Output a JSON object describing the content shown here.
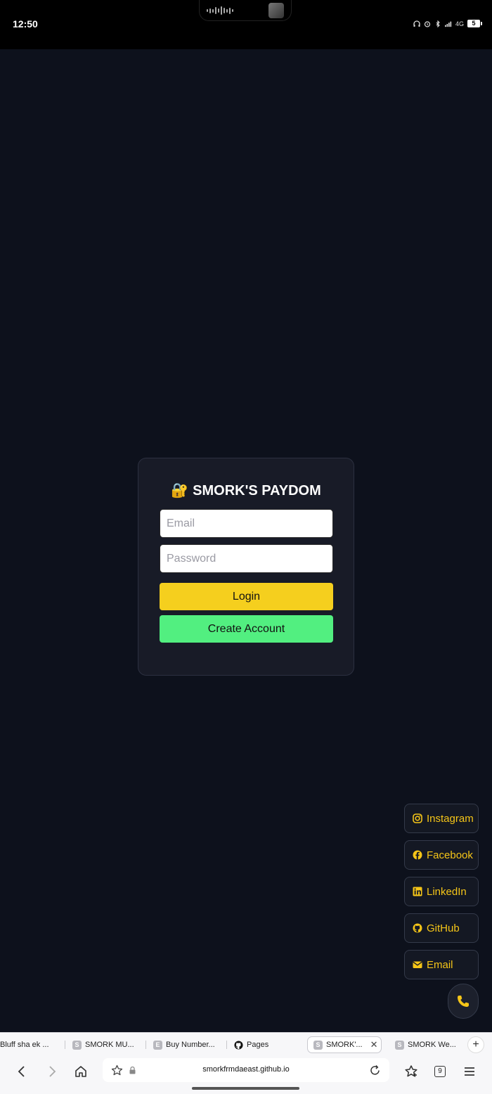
{
  "status_bar": {
    "time": "12:50",
    "network_label": "4G",
    "battery_level": "5"
  },
  "login": {
    "lock_emoji": "🔐",
    "title": "SMORK'S PAYDOM",
    "email_placeholder": "Email",
    "password_placeholder": "Password",
    "login_label": "Login",
    "create_account_label": "Create Account"
  },
  "social_links": [
    {
      "label": "Instagram",
      "icon": "instagram-icon"
    },
    {
      "label": "Facebook",
      "icon": "facebook-icon"
    },
    {
      "label": "LinkedIn",
      "icon": "linkedin-icon"
    },
    {
      "label": "GitHub",
      "icon": "github-icon"
    },
    {
      "label": "Email",
      "icon": "mail-icon"
    }
  ],
  "call_button": {
    "icon": "phone-icon"
  },
  "browser": {
    "tabs": [
      {
        "title": "Bluff sha ek ...",
        "favicon": ""
      },
      {
        "title": "SMORK MU...",
        "favicon": "S"
      },
      {
        "title": "Buy Number...",
        "favicon": "E"
      },
      {
        "title": "Pages",
        "favicon": "github-icon"
      },
      {
        "title": "SMORK'...",
        "favicon": "S",
        "active": true
      },
      {
        "title": "SMORK We...",
        "favicon": "S"
      }
    ],
    "url": "smorkfrmdaeast.github.io",
    "tab_count": "9"
  },
  "colors": {
    "background": "#0d111c",
    "card": "#181b27",
    "login_button": "#f5cf1e",
    "create_button": "#52ef80",
    "social_accent": "#f5c518"
  }
}
